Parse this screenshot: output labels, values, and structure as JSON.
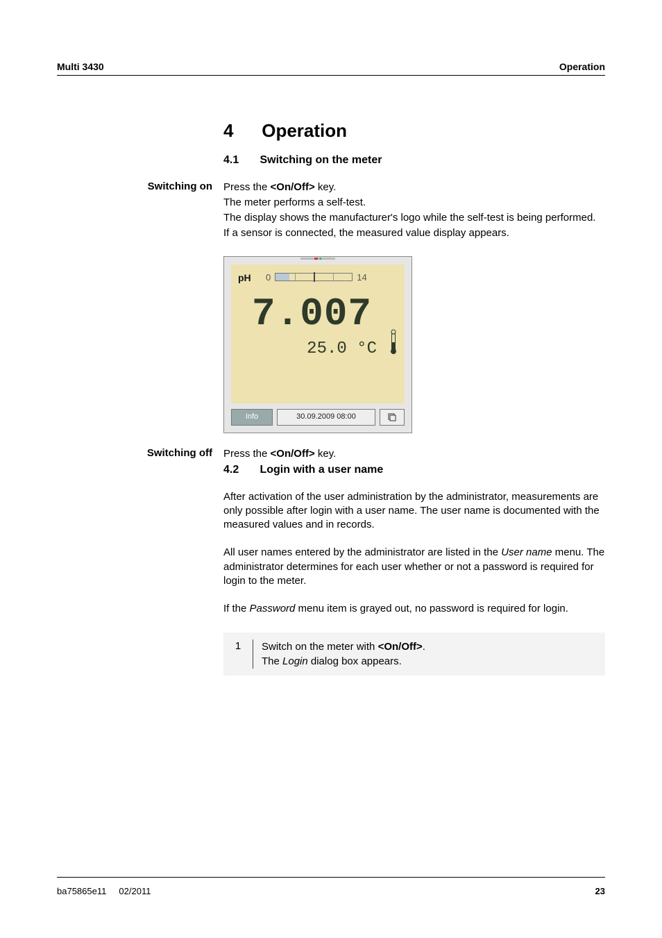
{
  "header": {
    "left": "Multi 3430",
    "right": "Operation"
  },
  "chapter": {
    "number": "4",
    "title": "Operation"
  },
  "sections": {
    "s41": {
      "number": "4.1",
      "title": "Switching on the meter"
    },
    "s42": {
      "number": "4.2",
      "title": "Login with a user name"
    }
  },
  "margin": {
    "on": "Switching on",
    "off": "Switching off"
  },
  "switching_on": {
    "l1a": "Press the ",
    "key": "<On/Off>",
    "l1b": " key.",
    "l2": "The meter performs a self-test.",
    "l3": "The display shows the manufacturer's logo while the self-test is being performed.",
    "l4": "If a sensor is connected, the measured value display appears."
  },
  "device": {
    "ph_label": "pH",
    "scale_min": "0",
    "scale_max": "14",
    "value": "7.007",
    "temp": "25.0 °C",
    "info": "Info",
    "datetime": "30.09.2009 08:00"
  },
  "switching_off": {
    "a": "Press the ",
    "key": "<On/Off>",
    "b": " key."
  },
  "login": {
    "p1": "After activation of the user administration by the administrator, measurements are only possible after login with a user name. The user name is documented with the measured values and in records.",
    "p2a": "All user names entered by the administrator are listed in the ",
    "p2i": "User name",
    "p2b": " menu. The administrator determines for each user whether or not a password is required for login to the meter.",
    "p3a": "If the ",
    "p3i": "Password",
    "p3b": " menu item is grayed out, no password is required for login."
  },
  "step": {
    "num": "1",
    "t1a": "Switch on the meter with ",
    "t1key": "<On/Off>",
    "t1b": ".",
    "t2a": "The ",
    "t2i": "Login",
    "t2b": " dialog box appears."
  },
  "footer": {
    "doc": "ba75865e11",
    "date": "02/2011",
    "page": "23"
  }
}
